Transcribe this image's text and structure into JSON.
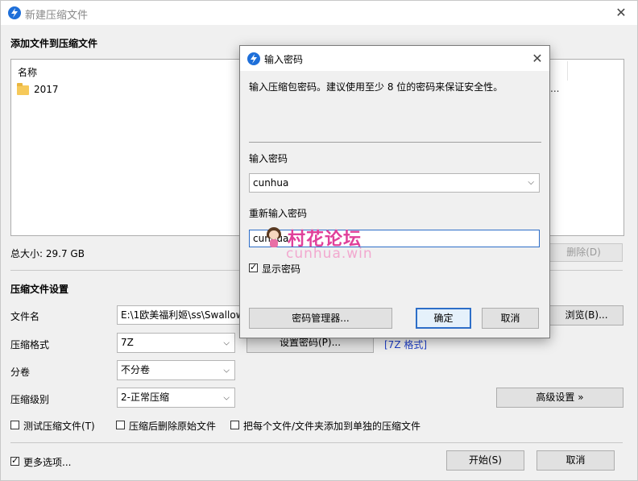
{
  "main": {
    "title": "新建压缩文件",
    "close": "✕",
    "add_files_heading": "添加文件到压缩文件",
    "list": {
      "header": "名称",
      "items": [
        {
          "name": "2017"
        }
      ],
      "right_truncated": "..."
    },
    "total_size": "总大小: 29.7 GB",
    "delete_button": "删除(D)",
    "settings_heading": "压缩文件设置",
    "filename_label": "文件名",
    "filename_value": "E:\\1欧美福利姬\\ss\\Swallow",
    "browse_button": "浏览(B)...",
    "format_label": "压缩格式",
    "format_value": "7Z",
    "set_password_button": "设置密码(P)...",
    "format_link": "[7Z 格式]",
    "split_label": "分卷",
    "split_value": "不分卷",
    "level_label": "压缩级别",
    "level_value": "2-正常压缩",
    "advanced_button": "高级设置 »",
    "checkboxes": [
      {
        "label": "测试压缩文件(T)",
        "checked": false
      },
      {
        "label": "压缩后删除原始文件",
        "checked": false
      },
      {
        "label": "把每个文件/文件夹添加到单独的压缩文件",
        "checked": false
      }
    ],
    "more_options": {
      "label": "更多选项...",
      "checked": true
    },
    "start_button": "开始(S)",
    "cancel_button": "取消"
  },
  "dialog": {
    "title": "输入密码",
    "close": "✕",
    "description": "输入压缩包密码。建议使用至少 8 位的密码来保证安全性。",
    "password_label": "输入密码",
    "password_value": "cunhua",
    "reenter_label": "重新输入密码",
    "reenter_value": "cunhua",
    "show_password": {
      "label": "显示密码",
      "checked": true
    },
    "manager_button": "密码管理器...",
    "ok_button": "确定",
    "cancel_button": "取消"
  },
  "watermark": {
    "text": "村花论坛",
    "url": "cunhua.win"
  },
  "colors": {
    "accent": "#1e6fd9",
    "link": "#1f3fc8",
    "watermark": "#e0409a"
  }
}
